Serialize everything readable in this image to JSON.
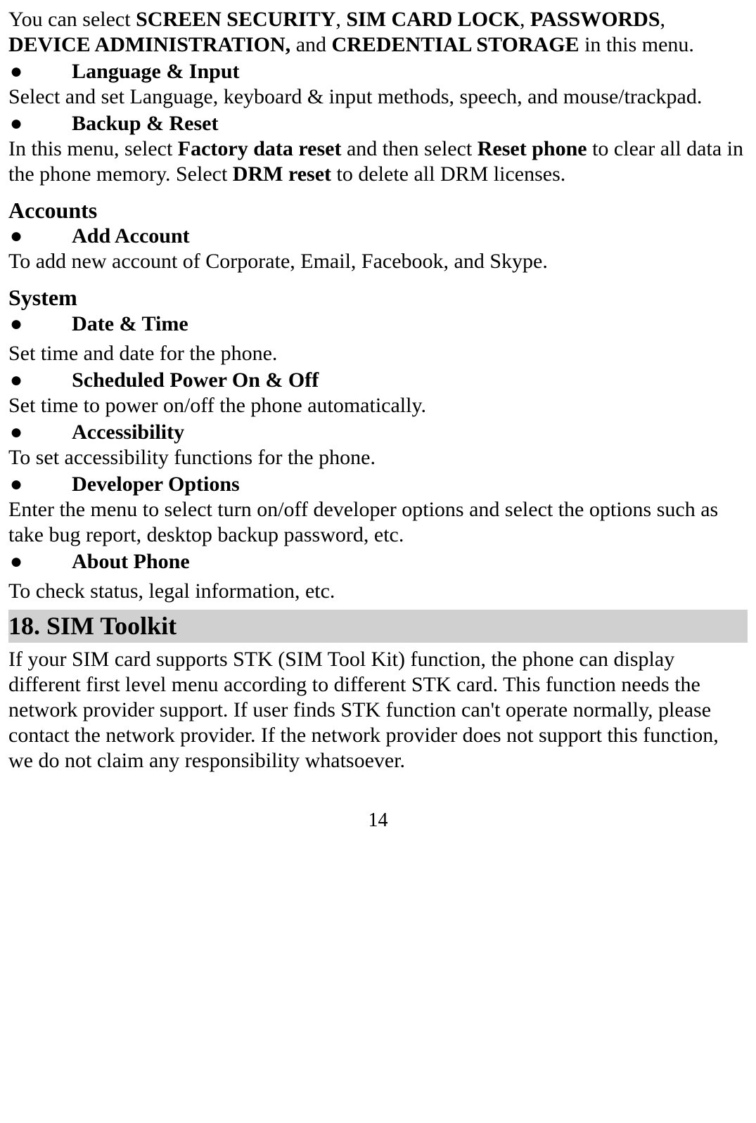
{
  "intro": {
    "part1": "You can select ",
    "b1": "SCREEN SECURITY",
    "sep1": ", ",
    "b2": "SIM CARD LOCK",
    "sep2": ", ",
    "b3": "PASSWORDS",
    "sep3": ", ",
    "b4": "DEVICE ADMINISTRATION,",
    "sep4": " and ",
    "b5": "CREDENTIAL STORAGE",
    "tail": " in this menu."
  },
  "language_input": {
    "title": "Language & Input",
    "desc": "Select and set Language, keyboard & input methods, speech, and mouse/trackpad."
  },
  "backup_reset": {
    "title": "Backup & Reset",
    "p1": "In this menu, select ",
    "b1": "Factory data reset",
    "p2": " and then select ",
    "b2": "Reset phone",
    "p3": " to clear all data in the phone memory. Select ",
    "b3": "DRM reset",
    "p4": " to delete all DRM licenses."
  },
  "accounts": {
    "heading": "Accounts",
    "add_account": {
      "title": "Add Account",
      "desc": "To add new account of Corporate, Email, Facebook, and Skype."
    }
  },
  "system": {
    "heading": "System",
    "date_time": {
      "title": "Date & Time",
      "desc": "Set time and date for the phone."
    },
    "scheduled_power": {
      "title": "Scheduled Power On & Off",
      "desc": "Set time to power on/off the phone automatically."
    },
    "accessibility": {
      "title": "Accessibility",
      "desc": "To set accessibility functions for the phone."
    },
    "developer": {
      "title": "Developer Options",
      "desc": "Enter the menu to select turn on/off developer options and select the options such as take bug report, desktop backup password, etc."
    },
    "about": {
      "title": "About Phone",
      "desc": "To check status, legal information, etc."
    }
  },
  "sim_toolkit": {
    "chapter": "18. SIM Toolkit",
    "desc": "If your SIM card supports STK (SIM Tool Kit) function, the phone can display different first level menu according to different STK card. This function needs the network provider support. If user finds STK function can't operate normally, please contact the network provider. If the network provider does not support this function, we do not claim any responsibility whatsoever."
  },
  "bullet": "●",
  "page_number": "14"
}
